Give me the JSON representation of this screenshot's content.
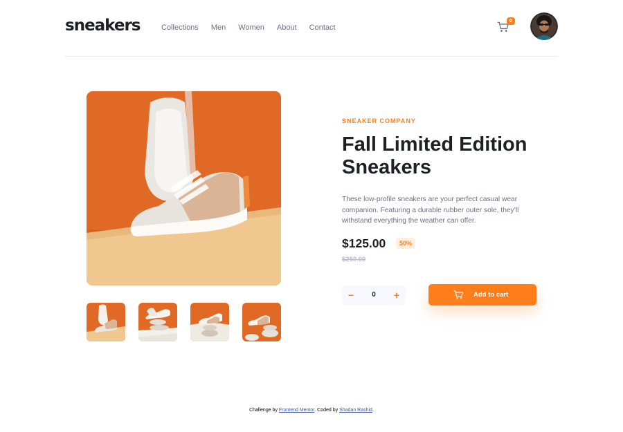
{
  "brand": {
    "logo": "sneakers"
  },
  "nav": [
    "Collections",
    "Men",
    "Women",
    "About",
    "Contact"
  ],
  "cart": {
    "count": "0",
    "icon": "cart-icon"
  },
  "avatar": {
    "icon": "avatar"
  },
  "colors": {
    "accent": "#ff7e1b",
    "accent_pale": "#ffede0",
    "text_dark": "#1d2025",
    "text_grey": "#69707d",
    "text_light": "#b6bcc8",
    "stepper_bg": "#f6f8fd"
  },
  "product": {
    "company": "SNEAKER COMPANY",
    "title": "Fall Limited Edition Sneakers",
    "description": "These low-profile sneakers are your perfect casual wear companion. Featuring a durable rubber outer sole, they’ll withstand everything the weather can offer.",
    "price": "$125.00",
    "discount": "50%",
    "old_price": "$250.00"
  },
  "quantity": {
    "minus": "−",
    "value": "0",
    "plus": "+"
  },
  "add_to_cart": {
    "label": "Add to cart",
    "icon": "cart-icon"
  },
  "footer": {
    "prefix": "Challenge by ",
    "link1": "Frontend Mentor",
    "middle": ". Coded by ",
    "link2": "Shadan Rashid",
    "suffix": "."
  }
}
